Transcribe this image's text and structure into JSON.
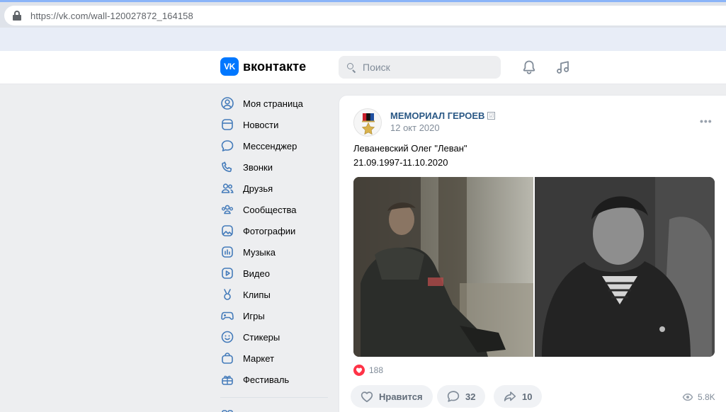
{
  "browser": {
    "url": "https://vk.com/wall-120027872_164158"
  },
  "header": {
    "logo_mark": "VK",
    "logo_text": "вконтакте",
    "search_placeholder": "Поиск"
  },
  "nav": {
    "items": [
      {
        "label": "Моя страница",
        "icon": "user-circle-icon"
      },
      {
        "label": "Новости",
        "icon": "news-icon"
      },
      {
        "label": "Мессенджер",
        "icon": "message-icon"
      },
      {
        "label": "Звонки",
        "icon": "phone-icon"
      },
      {
        "label": "Друзья",
        "icon": "friends-icon"
      },
      {
        "label": "Сообщества",
        "icon": "communities-icon"
      },
      {
        "label": "Фотографии",
        "icon": "photo-icon"
      },
      {
        "label": "Музыка",
        "icon": "music-icon"
      },
      {
        "label": "Видео",
        "icon": "video-icon"
      },
      {
        "label": "Клипы",
        "icon": "clips-icon"
      },
      {
        "label": "Игры",
        "icon": "gamepad-icon"
      },
      {
        "label": "Стикеры",
        "icon": "smile-icon"
      },
      {
        "label": "Маркет",
        "icon": "bag-icon"
      },
      {
        "label": "Фестиваль",
        "icon": "gift-icon"
      }
    ]
  },
  "post": {
    "author": "МЕМОРИАЛ ГЕРОЕВ",
    "verified_glyph": "☑",
    "date": "12 окт 2020",
    "more": "•••",
    "text_line1": "Леваневский Олег \"Леван\"",
    "text_line2": "21.09.1997-11.10.2020",
    "likes_count": "188",
    "like_label": "Нравится",
    "comments_count": "32",
    "shares_count": "10",
    "views": "5.8K"
  },
  "colors": {
    "accent": "#0077ff",
    "link": "#2a5885",
    "like": "#ff3347"
  }
}
